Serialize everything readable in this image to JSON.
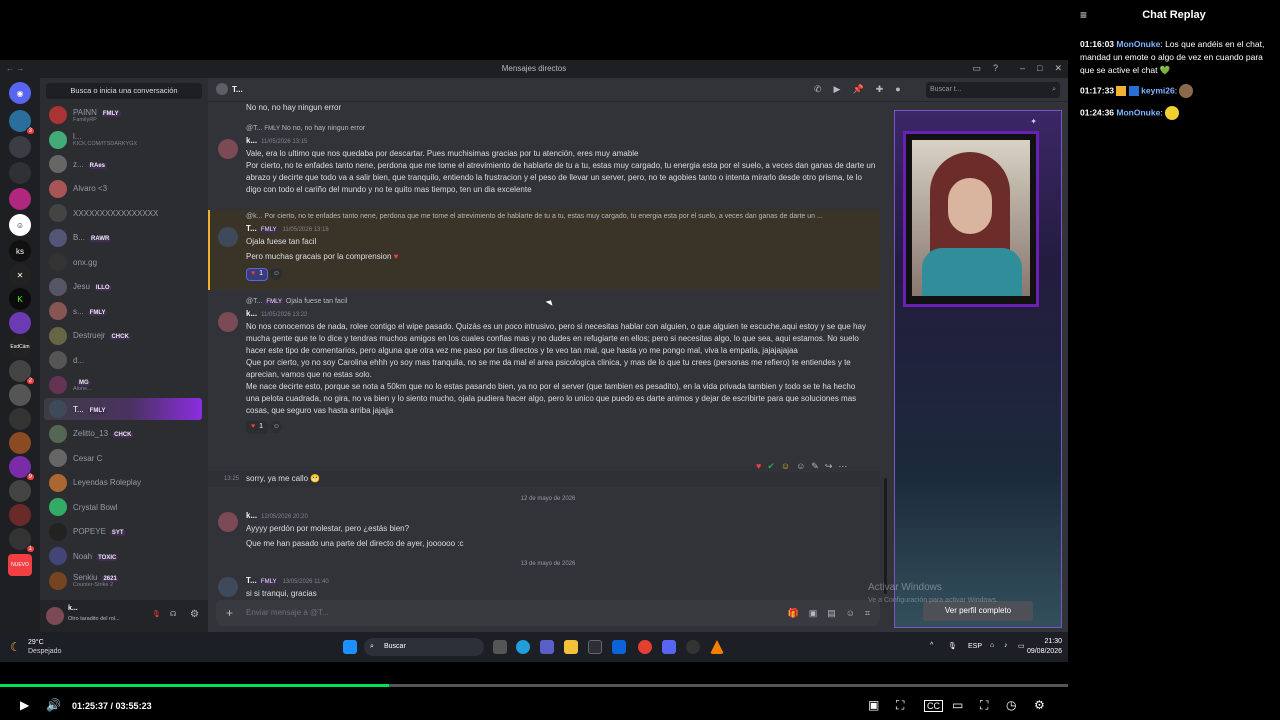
{
  "window": {
    "title": "Mensajes directos"
  },
  "dm_sidebar": {
    "search_label": "Busca o inicia una conversación",
    "items": [
      {
        "name": "PAINN",
        "tag": "FMLY",
        "sub": "FamilyRP"
      },
      {
        "name": "l...",
        "tag": "",
        "sub": "KICK.COM/ITSDARKYGX"
      },
      {
        "name": "z...",
        "tag": "RAes",
        "sub": ""
      },
      {
        "name": "Alvaro <3",
        "tag": "",
        "sub": ""
      },
      {
        "name": "XXXXXXXXXXXXXXXX",
        "tag": "",
        "sub": ""
      },
      {
        "name": "B...",
        "tag": "RAWR",
        "sub": ""
      },
      {
        "name": "onx.gg",
        "tag": "",
        "sub": ""
      },
      {
        "name": "Jesu",
        "tag": "ILLO",
        "sub": ""
      },
      {
        "name": "s...",
        "tag": "FMLY",
        "sub": ""
      },
      {
        "name": "Destruejr",
        "tag": "CHCK",
        "sub": ""
      },
      {
        "name": "d...",
        "tag": "",
        "sub": ""
      },
      {
        "name": "",
        "tag": "MG",
        "sub": "Alone..."
      },
      {
        "name": "T...",
        "tag": "FMLY",
        "sub": ""
      },
      {
        "name": "Zelitto_13",
        "tag": "CHCK",
        "sub": ""
      },
      {
        "name": "Cesar C",
        "tag": "",
        "sub": ""
      },
      {
        "name": "Leyendas Roleplay",
        "tag": "",
        "sub": ""
      },
      {
        "name": "Crystal Bowl",
        "tag": "",
        "sub": ""
      },
      {
        "name": "POPEYE",
        "tag": "SYT",
        "sub": ""
      },
      {
        "name": "Noah",
        "tag": "TOXIC",
        "sub": ""
      },
      {
        "name": "Senkiu",
        "tag": "2621",
        "sub": "Counter-Strike 2"
      }
    ],
    "user": {
      "name": "k...",
      "status": "Otro taradito del rol..."
    }
  },
  "servers": {
    "badges": [
      "3",
      "2",
      "9",
      "1"
    ],
    "labels": [
      "ks",
      "EsdCám"
    ],
    "new_label": "NUEVO"
  },
  "chat": {
    "header_name": "T...",
    "search_placeholder": "Buscar t...",
    "top_line": "No no, no hay ningun error",
    "messages": [
      {
        "reply_author": "@T...",
        "reply_tag": "FMLY",
        "reply_text": "No no, no hay ningun error",
        "author": "k...",
        "time": "11/05/2026 13:15",
        "lines": [
          "Vale, era lo ultimo que nos quedaba por descartar. Pues muchisimas gracias por tu atención, eres muy amable",
          "Por cierto, no te enfades tanto nene, perdona que me tome el atrevimiento de hablarte de tu a tu, estas muy cargado, tu energia esta por el suelo, a veces dan ganas de darte un abrazo y decirte que todo va a salir bien, que tranquilo, entiendo la frustracion y el peso de llevar un server, pero, no te agobies tanto o intenta mirarlo desde otro prisma, te lo digo con todo el cariño del mundo y no te quito mas tiempo, ten un dia excelente"
        ]
      },
      {
        "reply_author": "@k...",
        "reply_tag": "",
        "reply_text": "Por cierto, no te enfades tanto nene, perdona que me tome el atrevimiento de hablarte de tu a tu, estas muy cargado, tu energia esta por el suelo, a veces dan ganas de darte un ...",
        "author": "T...",
        "tag": "FMLY",
        "time": "11/05/2026 13:18",
        "lines": [
          "Ojala fuese tan facil",
          "Pero muchas gracais por la comprension"
        ],
        "reaction_count": "1"
      },
      {
        "reply_author": "@T...",
        "reply_tag": "FMLY",
        "reply_text": "Ojala fuese tan facil",
        "author": "k...",
        "time": "11/05/2026 13:22",
        "lines": [
          "No nos conocemos de nada, rolee contigo el wipe pasado. Quizás es un poco intrusivo, pero si necesitas hablar con alguien, o que alguien te escuche,aqui estoy y se que hay mucha gente que te lo dice y tendras muchos amigos en los cuales confias mas y no dudes en refugiarte en ellos; pero si necesitas algo, lo que sea, aqui estamos. No suelo hacer este tipo de comentarios, pero alguna que otra vez me paso por tus directos y te veo tan mal, que hasta yo me pongo mal, viva la empatia, jajajajajaa",
          "Que por cierto, yo no soy Carolina ehhh yo soy mas tranquila, no se me da mal el area psicologica clinica, y mas de lo que tu crees (personas me refiero) te entiendes y te aprecian, vamos que no estas solo.",
          "Me nace decirte esto, porque se nota a 50km que no lo estas pasando bien, ya no por el server (que tambien es pesadito), en la vida privada tambien y todo se te ha hecho una pelota cuadrada, no gira, no va bien y lo siento mucho, ojala pudiera hacer algo, pero lo unico que puedo es darte animos y dejar de escribirte para que soluciones mas cosas, que seguro vas hasta arriba jajajja"
        ],
        "reaction_count": "1"
      },
      {
        "time": "13:25",
        "lines": [
          "sorry, ya me callo"
        ]
      },
      {
        "date": "12 de mayo de 2026"
      },
      {
        "author": "k...",
        "time": "12/05/2026 20:20",
        "lines": [
          "Ayyyy perdón por molestar, pero ¿estás bien?",
          "Que me han pasado una parte del directo de ayer, joooooo :c"
        ]
      },
      {
        "date": "13 de mayo de 2026"
      },
      {
        "author": "T...",
        "tag": "FMLY",
        "time": "13/05/2026 11:40",
        "lines": [
          "si si tranqui, gracias"
        ]
      }
    ],
    "composer_placeholder": "Enviar mensaje a @T..."
  },
  "profile": {
    "button": "Ver perfil completo"
  },
  "windows_watermark": {
    "title": "Activar Windows",
    "sub": "Ve a Configuración para activar Windows."
  },
  "taskbar": {
    "weather_temp": "29°C",
    "weather_desc": "Despejado",
    "search": "Buscar",
    "lang": "ESP",
    "time": "21:30",
    "date": "09/08/2026"
  },
  "player": {
    "current": "01:25:37",
    "total": "03:55:23",
    "progress": 0.3644
  },
  "chat_replay": {
    "title": "Chat Replay",
    "entries": [
      {
        "time": "01:16:03",
        "user": "MonOnuke",
        "text": "Los que andéis en el chat, mandad un emote o algo de vez en cuando para que se active el chat 💚"
      },
      {
        "time": "01:17:33",
        "user": "keymi26",
        "text": ""
      },
      {
        "time": "01:24:36",
        "user": "MonOnuke",
        "text": ""
      }
    ]
  }
}
